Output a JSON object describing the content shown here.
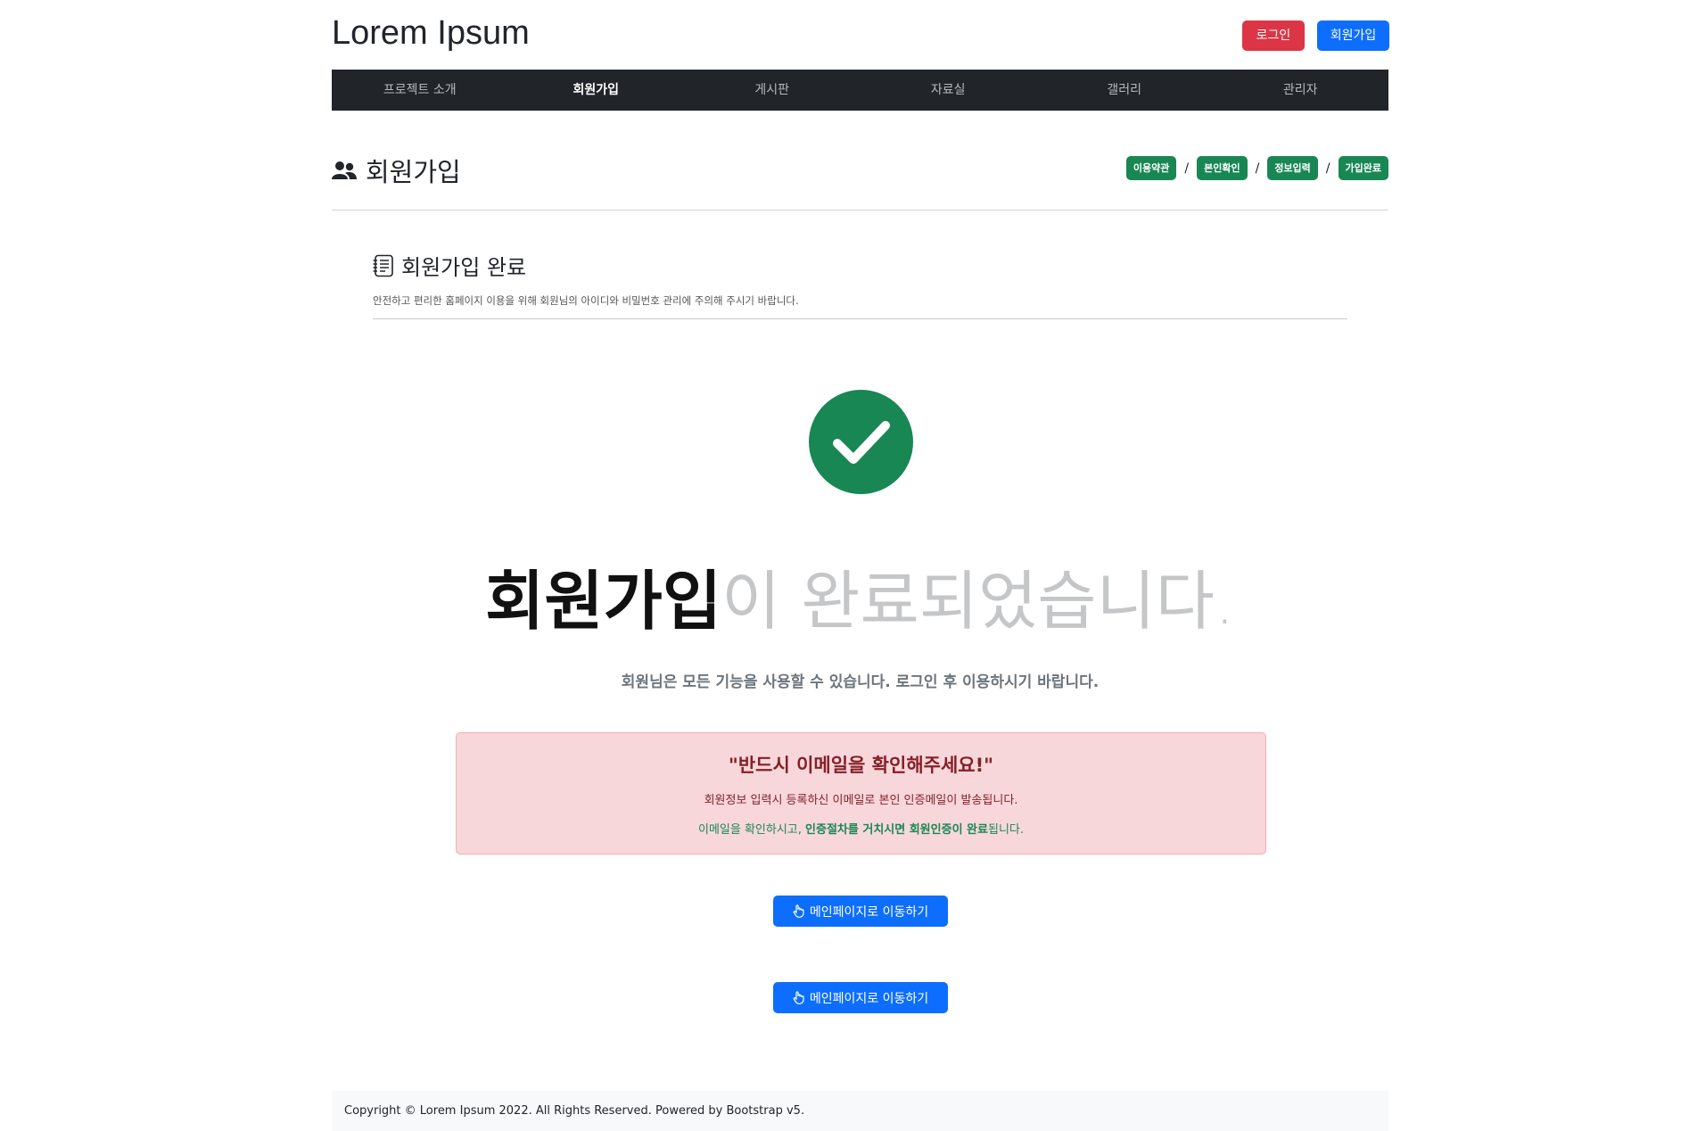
{
  "header": {
    "site_title": "Lorem Ipsum",
    "login_label": "로그인",
    "join_label": "회원가입"
  },
  "nav": {
    "items": [
      "프로젝트 소개",
      "회원가입",
      "게시판",
      "자료실",
      "갤러리",
      "관리자"
    ],
    "active": "회원가입"
  },
  "page": {
    "title": "회원가입",
    "steps": [
      "이용약관",
      "본인확인",
      "정보입력",
      "가입완료"
    ],
    "step_separator": "/"
  },
  "section": {
    "title": "회원가입 완료",
    "description": "안전하고 편리한 홈페이지 이용을 위해 회원님의 아이디와 비밀번호 관리에 주의해 주시기 바랍니다."
  },
  "result": {
    "headline_bold": "회원가입",
    "headline_light": "이 완료되었습니다.",
    "subtext": "회원님은 모든 기능을 사용할 수 있습니다. 로그인 후 이용하시기 바랍니다."
  },
  "alert": {
    "title": "\"반드시 이메일을 확인해주세요!\"",
    "line1": "회원정보 입력시 등록하신 이메일로 본인 인증메일이 발송됩니다.",
    "line2_prefix": "이메일을 확인하시고, ",
    "line2_bold": "인증절차를 거치시면 회원인증이 완료",
    "line2_suffix": "됩니다."
  },
  "buttons": {
    "main_page_1": "메인페이지로 이동하기",
    "main_page_2": "메인페이지로 이동하기"
  },
  "footer": {
    "text": "Copyright © Lorem Ipsum 2022. All Rights Reserved. Powered by Bootstrap v5."
  },
  "colors": {
    "danger": "#dc3545",
    "primary": "#0d6efd",
    "success": "#198754",
    "dark": "#212529"
  }
}
